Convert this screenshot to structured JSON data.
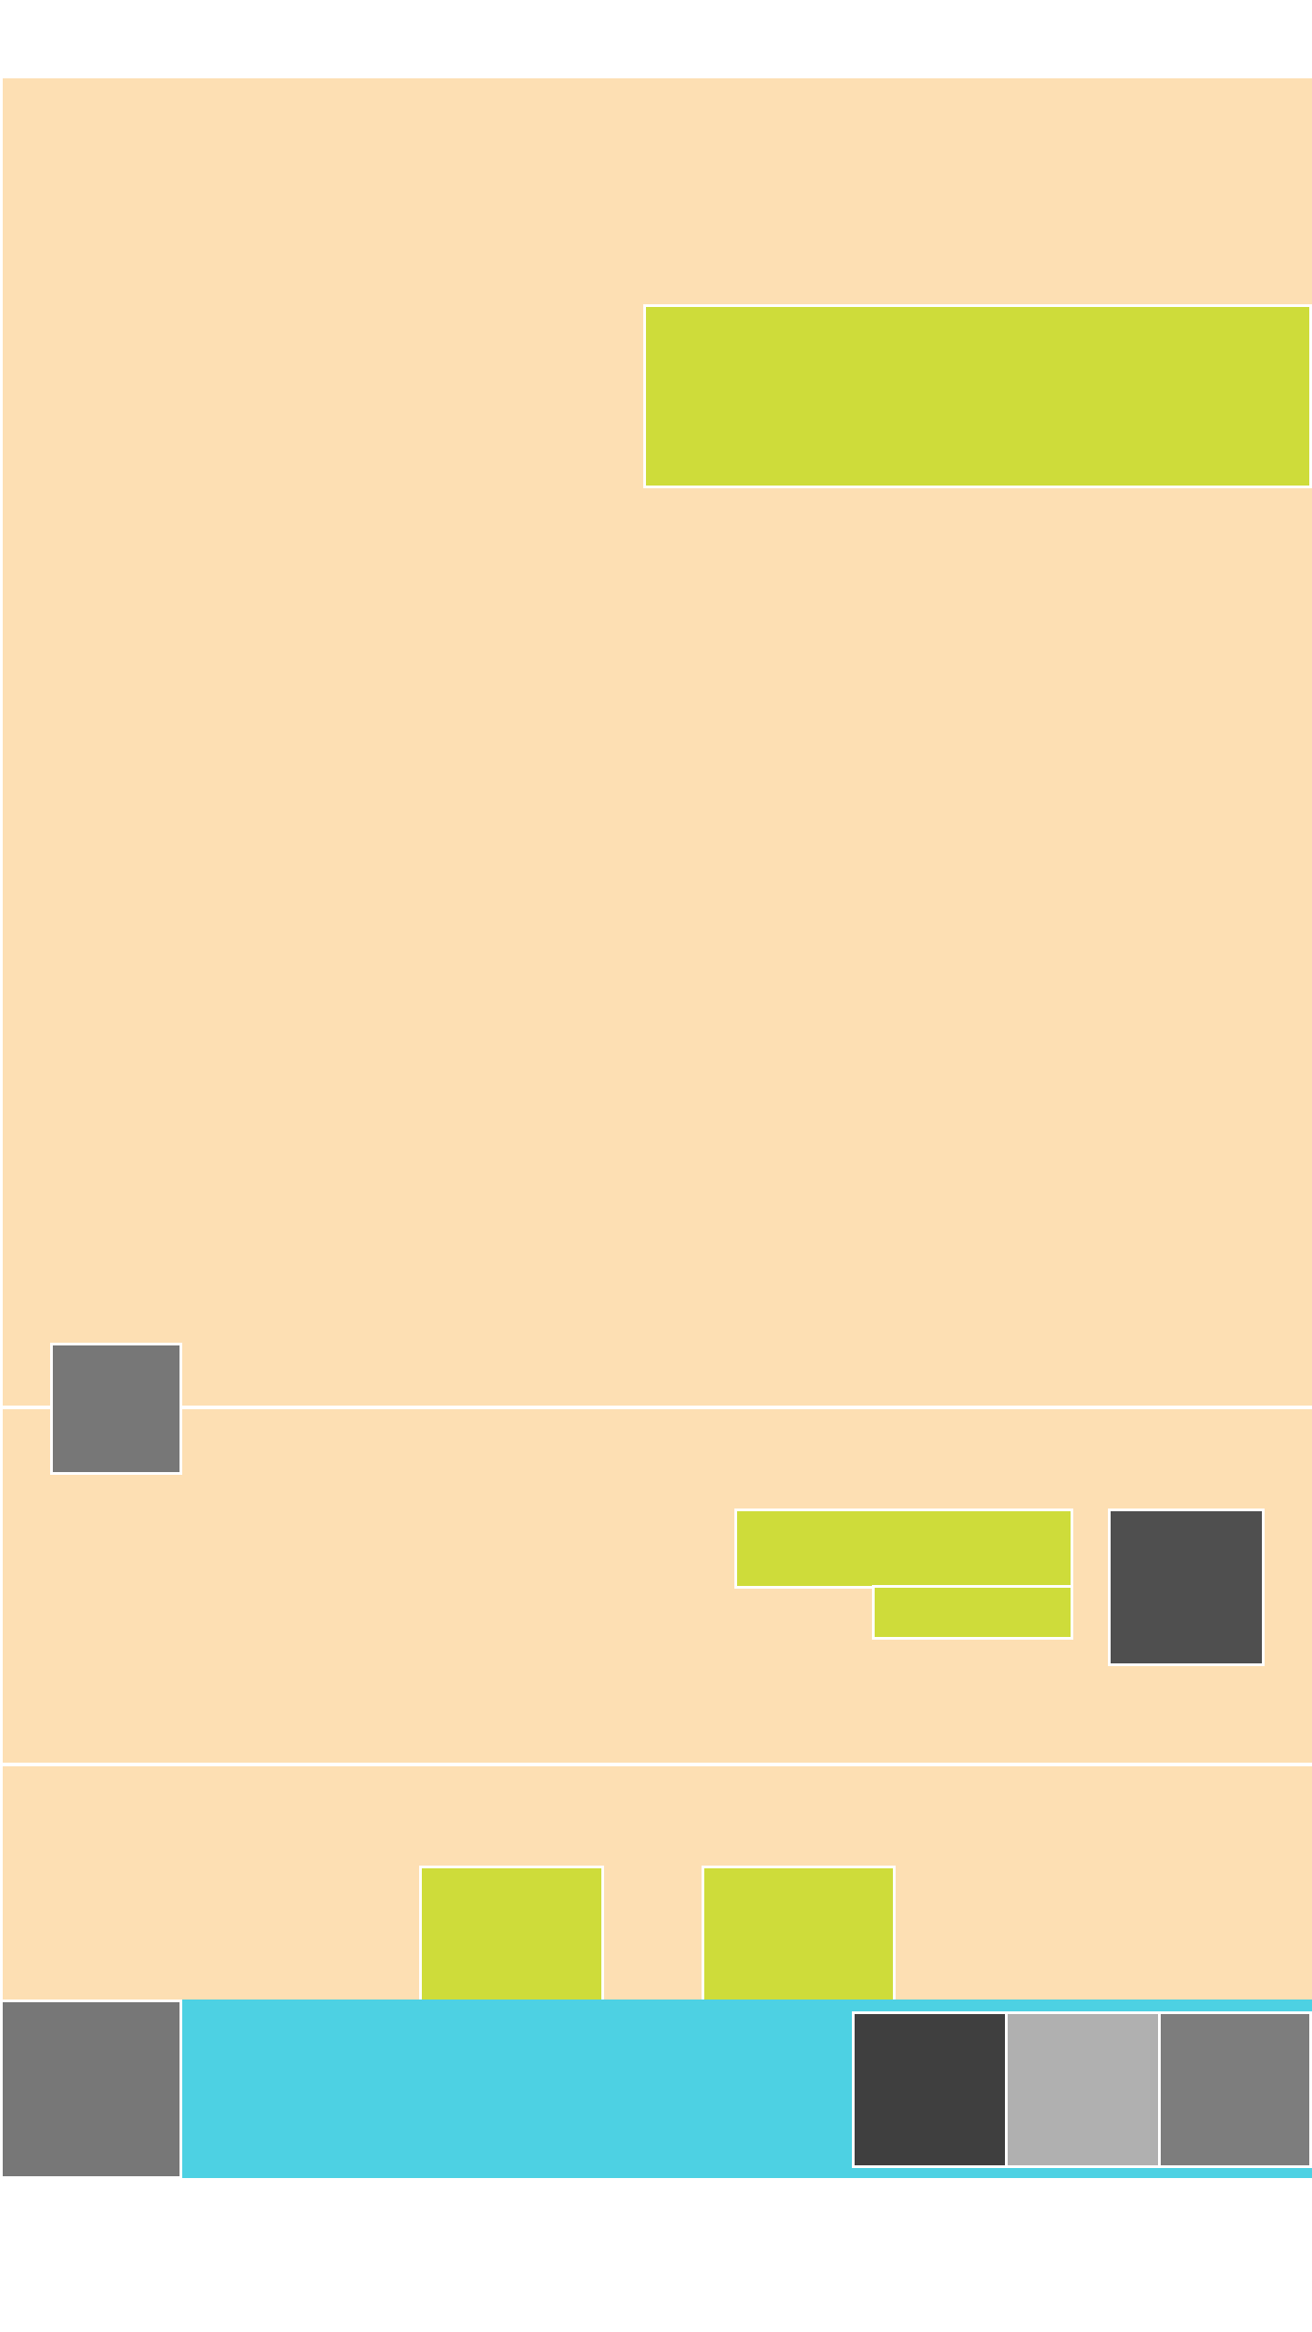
{
  "colors": {
    "background": "#ffffff",
    "panel": "#fddfb3",
    "accent_lime": "#cedc3a",
    "accent_cyan": "#4dd1e3",
    "gray_dark": "#3f3f3f",
    "gray_mid": "#777777",
    "gray_mid_alt": "#7d7d7d",
    "gray_light": "#b0b0b0",
    "gray_dark_alt": "#4f4f4f"
  },
  "sections": {
    "top": {
      "banner_label": ""
    },
    "middle": {
      "primary_label": "",
      "secondary_label": ""
    },
    "lower": {
      "button_left_label": "",
      "button_right_label": ""
    },
    "bottom_bar": {
      "label": ""
    }
  }
}
